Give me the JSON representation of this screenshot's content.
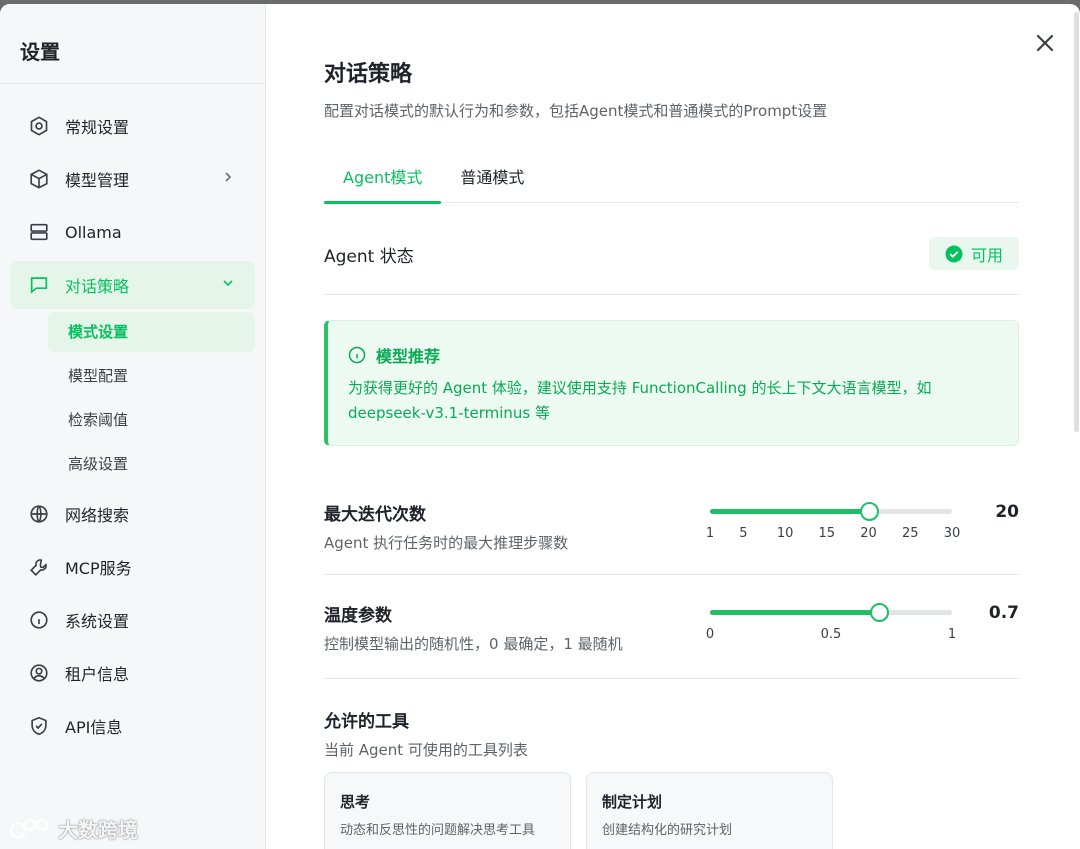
{
  "sidebar": {
    "title": "设置",
    "items": [
      {
        "label": "常规设置",
        "icon": "settings-hex-icon"
      },
      {
        "label": "模型管理",
        "icon": "cube-icon"
      },
      {
        "label": "Ollama",
        "icon": "server-icon"
      },
      {
        "label": "对话策略",
        "icon": "chat-icon"
      },
      {
        "label": "网络搜索",
        "icon": "globe-icon"
      },
      {
        "label": "MCP服务",
        "icon": "wrench-icon"
      },
      {
        "label": "系统设置",
        "icon": "info-icon"
      },
      {
        "label": "租户信息",
        "icon": "user-circle-icon"
      },
      {
        "label": "API信息",
        "icon": "shield-icon"
      }
    ],
    "sub_items": [
      "模式设置",
      "模型配置",
      "检索阈值",
      "高级设置"
    ],
    "watermark": "大数跨境"
  },
  "main": {
    "title": "对话策略",
    "description": "配置对话模式的默认行为和参数，包括Agent模式和普通模式的Prompt设置",
    "tabs": [
      "Agent模式",
      "普通模式"
    ],
    "active_tab": 0,
    "agent_status": {
      "label": "Agent 状态",
      "badge": "可用"
    },
    "tip": {
      "title": "模型推荐",
      "body": "为获得更好的 Agent 体验，建议使用支持 FunctionCalling 的长上下文大语言模型，如 deepseek-v3.1-terminus 等"
    },
    "max_iterations": {
      "label": "最大迭代次数",
      "desc": "Agent 执行任务时的最大推理步骤数",
      "value": "20",
      "min": 1,
      "max": 30,
      "current": 20,
      "ticks": [
        "1",
        "5",
        "10",
        "15",
        "20",
        "25",
        "30"
      ]
    },
    "temperature": {
      "label": "温度参数",
      "desc": "控制模型输出的随机性，0 最确定，1 最随机",
      "value": "0.7",
      "min": 0,
      "max": 1,
      "current": 0.7,
      "ticks": [
        "0",
        "0.5",
        "1"
      ]
    },
    "tools": {
      "title": "允许的工具",
      "desc": "当前 Agent 可使用的工具列表",
      "items": [
        {
          "name": "思考",
          "desc": "动态和反思性的问题解决思考工具"
        },
        {
          "name": "制定计划",
          "desc": "创建结构化的研究计划"
        }
      ]
    }
  },
  "colors": {
    "accent": "#07c160",
    "sidebar_bg": "#f6f7f8",
    "tip_bg": "#edfaf1"
  }
}
